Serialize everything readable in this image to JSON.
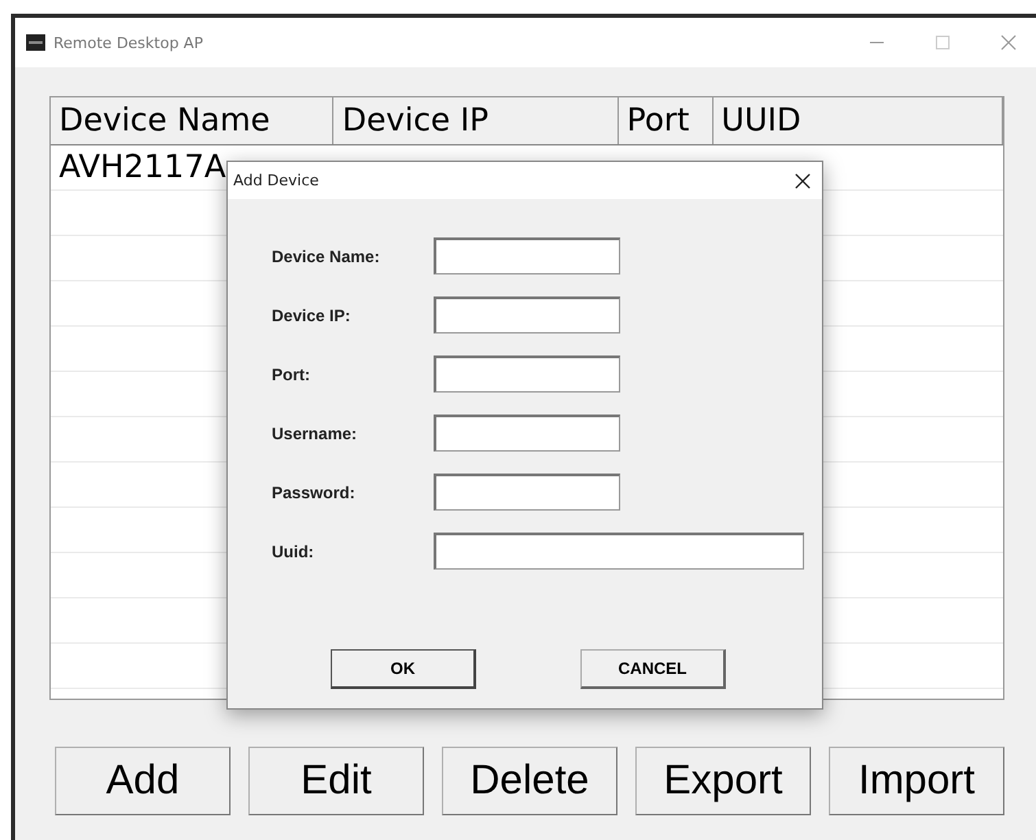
{
  "window": {
    "title": "Remote Desktop AP"
  },
  "table": {
    "columns": [
      "Device Name",
      "Device IP",
      "Port",
      "UUID"
    ],
    "rows": [
      {
        "device_name": "AVH2117A"
      }
    ]
  },
  "buttons": [
    "Add",
    "Edit",
    "Delete",
    "Export",
    "Import"
  ],
  "dialog": {
    "title": "Add Device",
    "fields": [
      {
        "label": "Device Name:",
        "wide": false
      },
      {
        "label": "Device IP:",
        "wide": false
      },
      {
        "label": "Port:",
        "wide": false
      },
      {
        "label": "Username:",
        "wide": false
      },
      {
        "label": "Password:",
        "wide": false
      },
      {
        "label": "Uuid:",
        "wide": true
      }
    ],
    "buttons": [
      "OK",
      "CANCEL"
    ]
  }
}
